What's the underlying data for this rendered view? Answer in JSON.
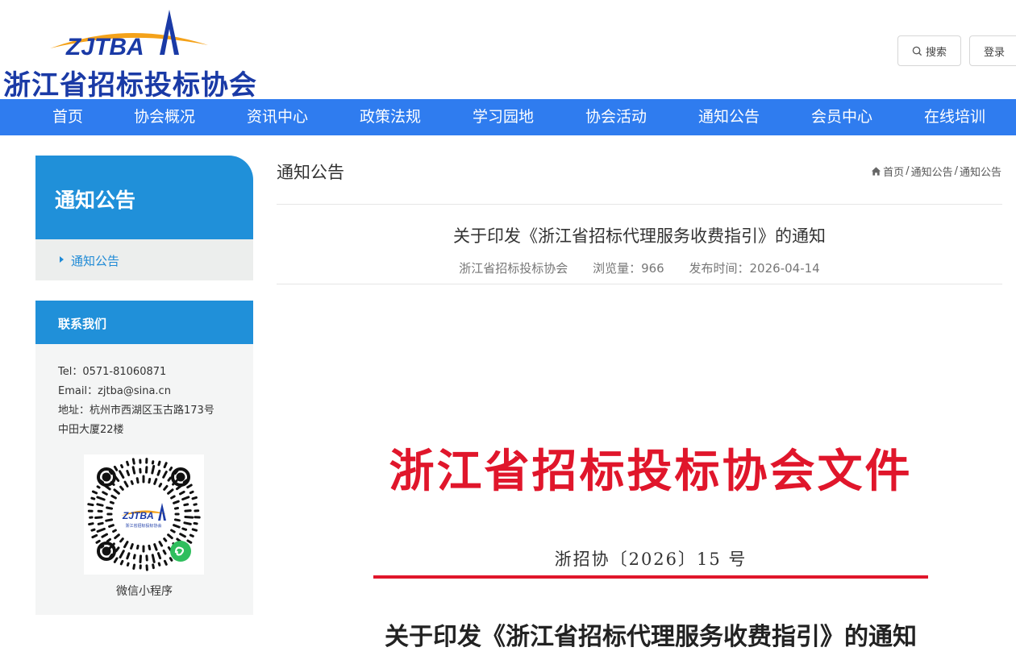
{
  "header": {
    "logo_mark_text": "ZJTBA",
    "logo_name": "浙江省招标投标协会",
    "search_label": "搜索",
    "login_label": "登录"
  },
  "nav": {
    "items": [
      {
        "label": "首页"
      },
      {
        "label": "协会概况"
      },
      {
        "label": "资讯中心"
      },
      {
        "label": "政策法规"
      },
      {
        "label": "学习园地"
      },
      {
        "label": "协会活动"
      },
      {
        "label": "通知公告"
      },
      {
        "label": "会员中心"
      },
      {
        "label": "在线培训"
      }
    ]
  },
  "sidebar": {
    "section_title": "通知公告",
    "link_label": "通知公告",
    "contact": {
      "title": "联系我们",
      "tel": "Tel：0571-81060871",
      "email": "Email：zjtba@sina.cn",
      "address_line1": "地址：杭州市西湖区玉古路173号",
      "address_line2": "中田大厦22楼",
      "qr_logo_text": "ZJTBA",
      "qr_logo_sub": "浙江省招标投标协会",
      "qr_caption": "微信小程序"
    }
  },
  "main": {
    "section_title": "通知公告",
    "breadcrumb": [
      "首页",
      "通知公告",
      "通知公告"
    ],
    "breadcrumb_sep": "/",
    "article": {
      "title": "关于印发《浙江省招标代理服务收费指引》的通知",
      "source": "浙江省招标投标协会",
      "views": "浏览量：966",
      "published": "发布时间：2026-04-14"
    },
    "document": {
      "header": "浙江省招标投标协会文件",
      "number": "浙招协〔2026〕15 号",
      "title": "关于印发《浙江省招标代理服务收费指引》的通知"
    }
  },
  "colors": {
    "nav_blue": "#2f7cef",
    "sidebar_blue": "#2090d9",
    "logo_blue": "#1a3aa6",
    "logo_orange": "#f4a21a",
    "document_red": "#e0162b",
    "wechat_green": "#2fbe5d"
  }
}
